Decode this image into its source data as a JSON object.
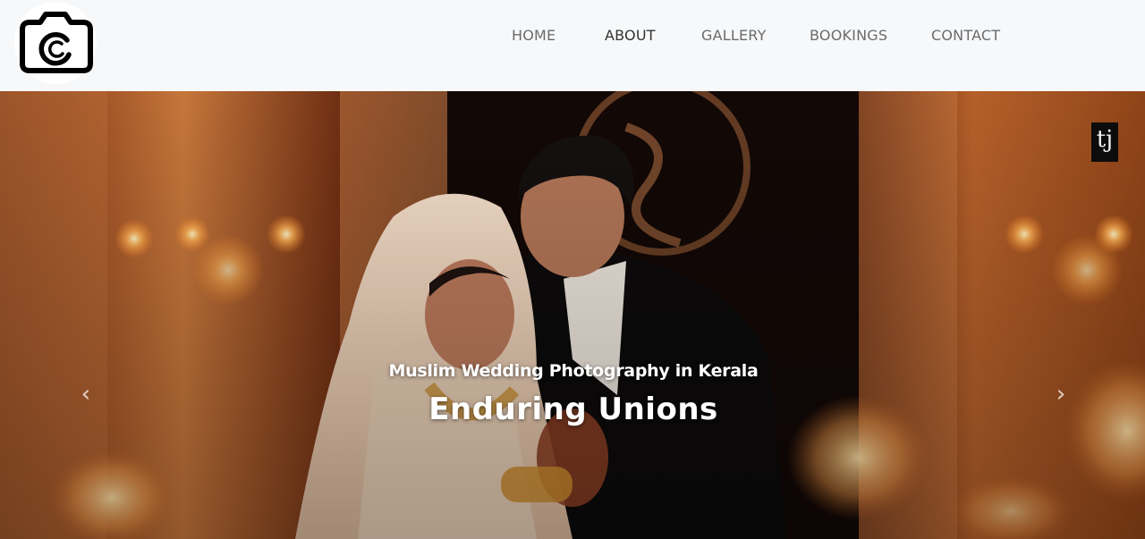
{
  "brand": {
    "logo_icon": "camera-icon"
  },
  "nav": {
    "home": "HOME",
    "about": "ABOUT",
    "gallery": "GALLERY",
    "bookings": "BOOKINGS",
    "contact": "CONTACT",
    "active": "about"
  },
  "hero": {
    "subtitle": "Muslim Wedding Photography in Kerala",
    "title": "Enduring Unions",
    "prev_icon": "chevron-left-icon",
    "next_icon": "chevron-right-icon",
    "watermark_text": "tj"
  },
  "colors": {
    "navbar_bg": "#f7f8fa",
    "nav_text": "#6b6b6b",
    "nav_active": "#333333",
    "caption_text": "#ffffff"
  }
}
